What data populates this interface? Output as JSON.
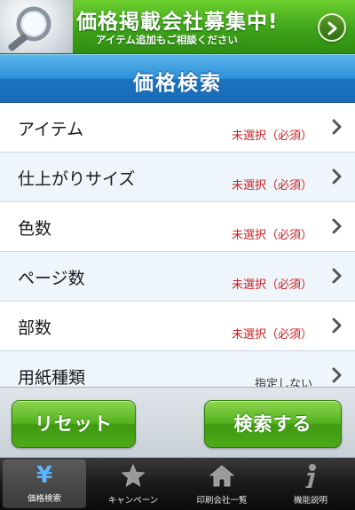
{
  "banner": {
    "title": "価格掲載会社募集中!",
    "subtitle": "アイテム追加もご相談ください"
  },
  "page_title": "価格検索",
  "rows": [
    {
      "label": "アイテム",
      "value": "未選択（必須）",
      "kind": "required"
    },
    {
      "label": "仕上がりサイズ",
      "value": "未選択（必須）",
      "kind": "required"
    },
    {
      "label": "色数",
      "value": "未選択（必須）",
      "kind": "required"
    },
    {
      "label": "ページ数",
      "value": "未選択（必須）",
      "kind": "required"
    },
    {
      "label": "部数",
      "value": "未選択（必須）",
      "kind": "required"
    },
    {
      "label": "用紙種類",
      "value": "指定しない",
      "kind": "optional"
    }
  ],
  "actions": {
    "reset_label": "リセット",
    "search_label": "検索する"
  },
  "tabs": [
    {
      "label": "価格検索",
      "icon": "yen-icon",
      "active": true
    },
    {
      "label": "キャンペーン",
      "icon": "star-icon",
      "active": false
    },
    {
      "label": "印刷会社一覧",
      "icon": "house-icon",
      "active": false
    },
    {
      "label": "機能説明",
      "icon": "info-icon",
      "active": false
    }
  ],
  "colors": {
    "required_text": "#cc1f1f",
    "banner_green": "#3ea41a",
    "title_blue": "#2d8fd8",
    "button_green": "#55b21f",
    "active_tab_icon": "#5ab4ff"
  }
}
